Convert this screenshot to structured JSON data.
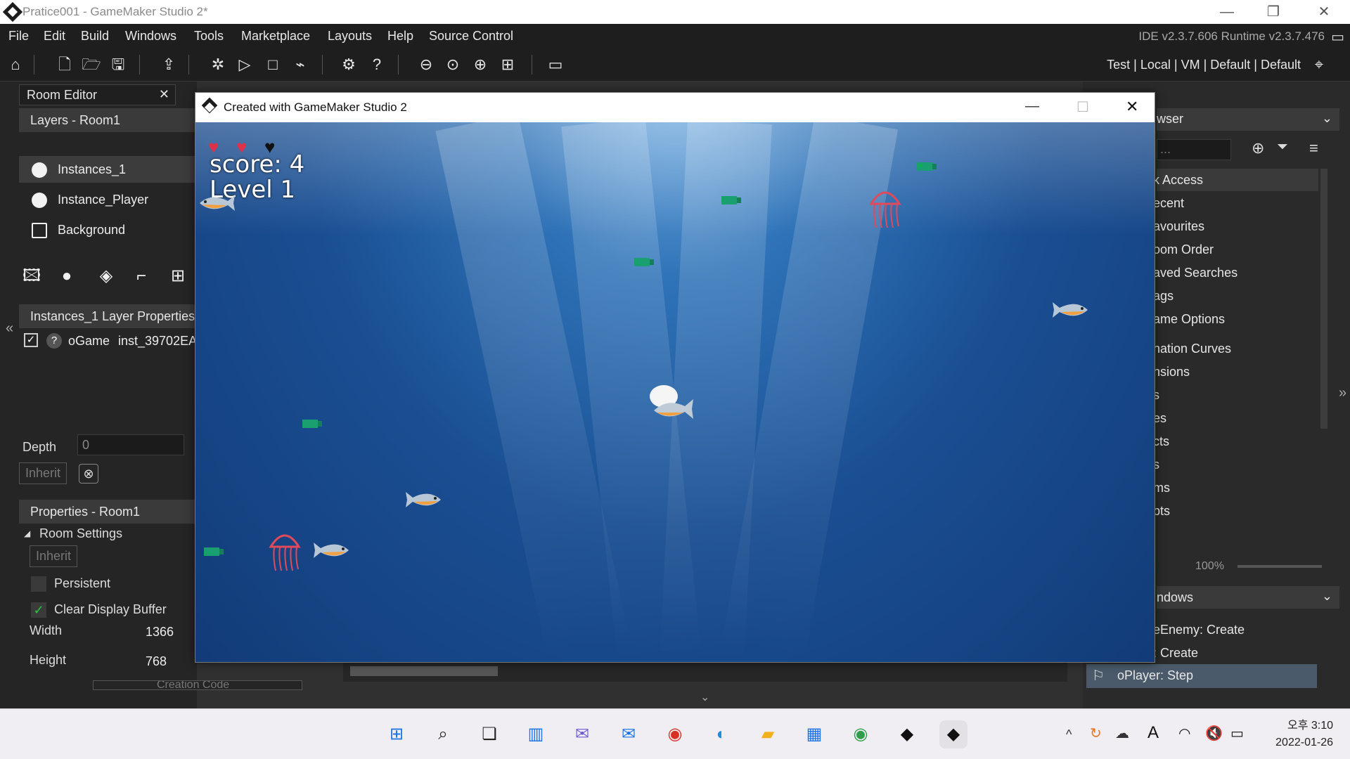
{
  "window": {
    "title": "Pratice001 - GameMaker Studio 2*"
  },
  "menu": {
    "items": [
      "File",
      "Edit",
      "Build",
      "Windows",
      "Tools",
      "Marketplace",
      "Layouts",
      "Help",
      "Source Control"
    ],
    "version": "IDE v2.3.7.606  Runtime v2.3.7.476"
  },
  "toolbar": {
    "targets": "Test | Local | VM | Default | Default"
  },
  "room_editor": {
    "tab": "Room Editor",
    "layers_header": "Layers - Room1",
    "layers": [
      "Instances_1",
      "Instance_Player",
      "Background"
    ],
    "layer_props_header": "Instances_1 Layer Properties",
    "instance_row": {
      "object": "oGame",
      "id": "inst_39702EA"
    },
    "depth_label": "Depth",
    "depth_value": "0",
    "inherit_label": "Inherit",
    "properties_header": "Properties - Room1",
    "room_settings": "Room Settings",
    "persistent": "Persistent",
    "clear_display_buffer": "Clear Display Buffer",
    "width_label": "Width",
    "width_value": "1366",
    "height_label": "Height",
    "height_value": "768",
    "creation_code": "Creation Code"
  },
  "asset_browser": {
    "header": "wser",
    "items": [
      "k Access",
      "ecent",
      "avourites",
      "oom Order",
      "aved Searches",
      "ags",
      "ame Options",
      "nation Curves",
      "nsions",
      "s",
      "es",
      "cts",
      "s",
      "ms",
      "pts"
    ],
    "zoom": "100%",
    "windows_header": "ndows",
    "windows": [
      "eEnemy: Create",
      ": Create",
      "oPlayer: Step"
    ]
  },
  "game": {
    "title": "Created with GameMaker Studio 2",
    "score_text": "score: 4",
    "level_text": "Level  1",
    "hearts_full": 2,
    "hearts_total": 3
  },
  "taskbar": {
    "time": "오후 3:10",
    "date": "2022-01-26"
  }
}
